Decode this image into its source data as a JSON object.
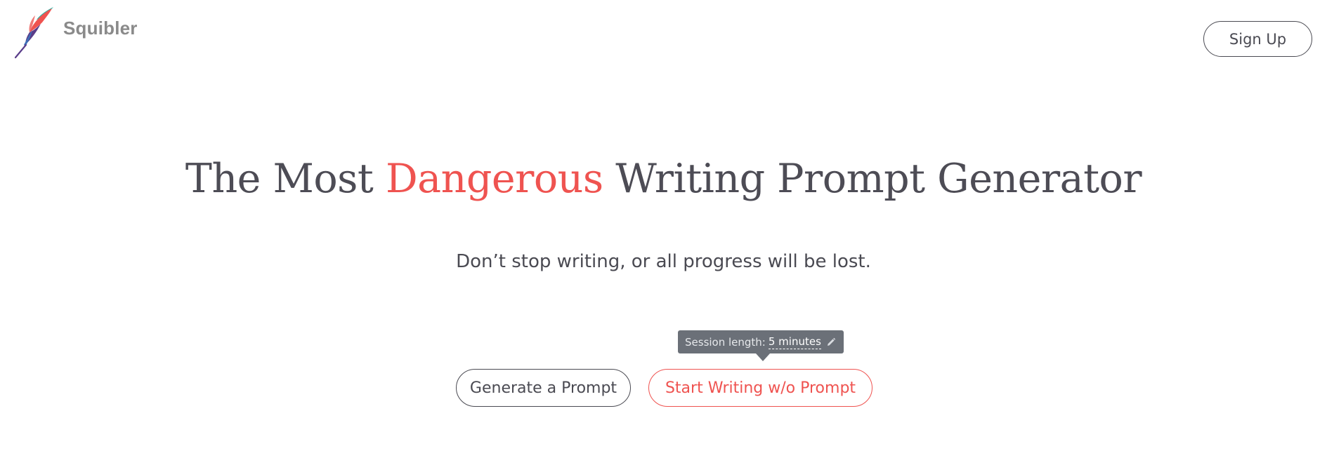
{
  "brand": {
    "name": "Squibler",
    "icon": "feather-quill-icon",
    "colors": {
      "text": "#8a8a8a",
      "quill_top": "#26b5a6",
      "quill_mid": "#ef5350",
      "quill_low": "#5a3d8a"
    }
  },
  "header": {
    "signup_label": "Sign Up"
  },
  "hero": {
    "title_part1": "The Most ",
    "title_accent": "Dangerous",
    "title_part2": " Writing Prompt Generator",
    "tagline": "Don’t stop writing, or all progress will be lost."
  },
  "session": {
    "label": "Session length:",
    "value": "5 minutes",
    "edit_icon": "pencil-icon"
  },
  "actions": {
    "generate_label": "Generate a Prompt",
    "start_label": "Start Writing w/o Prompt"
  },
  "theme": {
    "text_dark": "#4a4a52",
    "accent": "#ef5350",
    "tooltip_bg": "#6b7078",
    "background": "#ffffff"
  }
}
